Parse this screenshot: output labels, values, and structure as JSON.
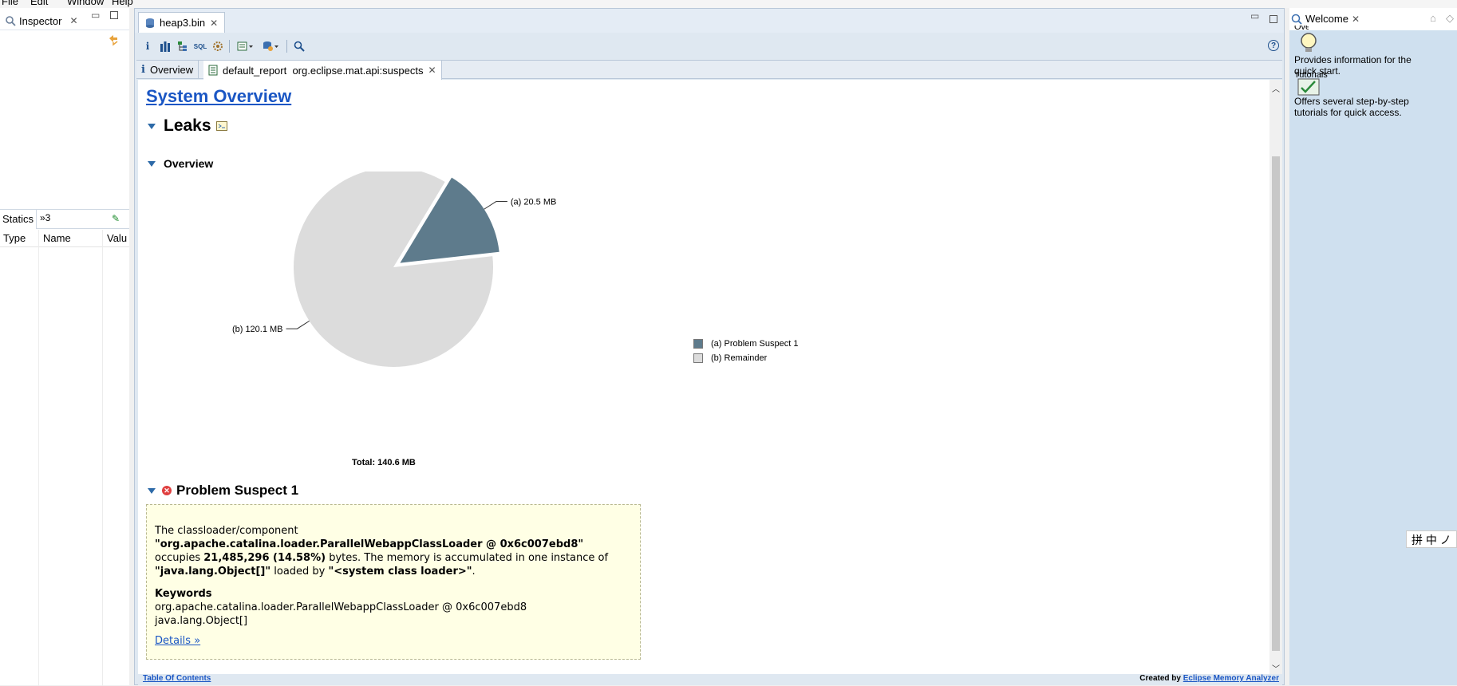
{
  "menu": {
    "items": [
      "File",
      "Edit",
      "Window",
      "Help"
    ]
  },
  "inspector": {
    "tab_label": "Inspector"
  },
  "statics": {
    "tab_label": "Statics",
    "overflow_label": "»3",
    "columns": [
      "Type",
      "Name",
      "Valu"
    ]
  },
  "editor": {
    "tab_label": "heap3.bin",
    "subtabs": {
      "overview": "Overview",
      "report": "default_report  org.eclipse.mat.api:suspects"
    }
  },
  "report": {
    "title": "System Overview",
    "leaks_heading": "Leaks",
    "overview_heading": "Overview",
    "problem_heading": "Problem Suspect 1",
    "suspect_text": {
      "line1": "The classloader/component",
      "loader": "\"org.apache.catalina.loader.ParallelWebappClassLoader @ 0x6c007ebd8\"",
      "occupies_pre": "occupies ",
      "occupies_value": "21,485,296 (14.58%)",
      "occupies_post": " bytes. The memory is accumulated in one instance of",
      "instance_type": "\"java.lang.Object[]\"",
      "loaded_by": " loaded by ",
      "system_loader": "\"<system class loader>\"",
      "period": ".",
      "keywords_label": "Keywords",
      "keyword1": "org.apache.catalina.loader.ParallelWebappClassLoader @ 0x6c007ebd8",
      "keyword2": "java.lang.Object[]",
      "details_link": "Details »"
    },
    "footer": {
      "toc_link": "Table Of Contents",
      "created_by": "Created by ",
      "mat_link": "Eclipse Memory Analyzer"
    }
  },
  "chart_data": {
    "type": "pie",
    "slices": [
      {
        "label": "(a)",
        "legend": "Problem Suspect 1",
        "value": 20.5,
        "value_label": "20.5 MB",
        "color": "#5e7b8c"
      },
      {
        "label": "(b)",
        "legend": "Remainder",
        "value": 120.1,
        "value_label": "120.1 MB",
        "color": "#dcdcdc"
      }
    ],
    "total_label": "Total: 140.6 MB"
  },
  "welcome": {
    "tab_label": "Welcome",
    "overview_title": "Overview",
    "overview_desc": "Provides information for the quick start.",
    "tutorials_title": "Tutorials",
    "tutorials_desc": "Offers several step-by-step tutorials for quick access."
  },
  "ime": {
    "chars": "拼 中 ノ"
  }
}
